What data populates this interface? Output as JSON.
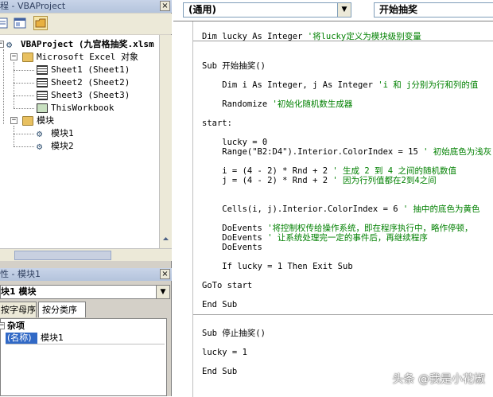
{
  "project_pane": {
    "title": "程 - VBAProject",
    "close_label": "×",
    "tree": {
      "project": "VBAProject (九宫格抽奖.xlsm",
      "excel_objects": "Microsoft Excel 对象",
      "sheets": [
        "Sheet1 (Sheet1)",
        "Sheet2 (Sheet2)",
        "Sheet3 (Sheet3)"
      ],
      "workbook": "ThisWorkbook",
      "modules_folder": "模块",
      "modules": [
        "模块1",
        "模块2"
      ],
      "expand_minus": "−"
    }
  },
  "properties_pane": {
    "title": "性 - 模块1",
    "close_label": "×",
    "object_combo": "块1 模块",
    "tabs": [
      "按字母序",
      "按分类序"
    ],
    "category": "杂项",
    "prop_name": "(名称)",
    "prop_value": "模块1"
  },
  "code_window": {
    "object_combo": "(通用)",
    "proc_combo": "开始抽奖",
    "combo_arrow": "▼",
    "lines": [
      {
        "code": "Dim lucky As Integer ",
        "comment": "'将lucky定义为模块级别变量"
      },
      {
        "code": "Sub 开始抽奖()",
        "comment": ""
      },
      {
        "code": "    Dim i As Integer, j As Integer ",
        "comment": "'i 和 j分别为行和列的值"
      },
      {
        "code": "    Randomize ",
        "comment": "'初始化随机数生成器"
      },
      {
        "code": "start:",
        "comment": ""
      },
      {
        "code": "    lucky = 0",
        "comment": ""
      },
      {
        "code": "    Range(\"B2:D4\").Interior.ColorIndex = 15 ",
        "comment": "' 初始底色为浅灰"
      },
      {
        "code": "    i = (4 - 2) * Rnd + 2 ",
        "comment": "' 生成 2 到 4 之间的随机数值"
      },
      {
        "code": "    j = (4 - 2) * Rnd + 2 ",
        "comment": "' 因为行列值都在2到4之间"
      },
      {
        "code": "    Cells(i, j).Interior.ColorIndex = 6 ",
        "comment": "' 抽中的底色为黄色"
      },
      {
        "code": "    DoEvents ",
        "comment": "'将控制权传给操作系统，即在程序执行中，略作停顿，"
      },
      {
        "code": "    DoEvents ",
        "comment": "' 让系统处理完一定的事件后，再继续程序"
      },
      {
        "code": "    DoEvents",
        "comment": ""
      },
      {
        "code": "    If lucky = 1 Then Exit Sub",
        "comment": ""
      },
      {
        "code": "GoTo start",
        "comment": ""
      },
      {
        "code": "End Sub",
        "comment": ""
      },
      {
        "code": "Sub 停止抽奖()",
        "comment": ""
      },
      {
        "code": "lucky = 1",
        "comment": ""
      },
      {
        "code": "End Sub",
        "comment": ""
      }
    ]
  },
  "watermark": "头条 @我是小花椒"
}
